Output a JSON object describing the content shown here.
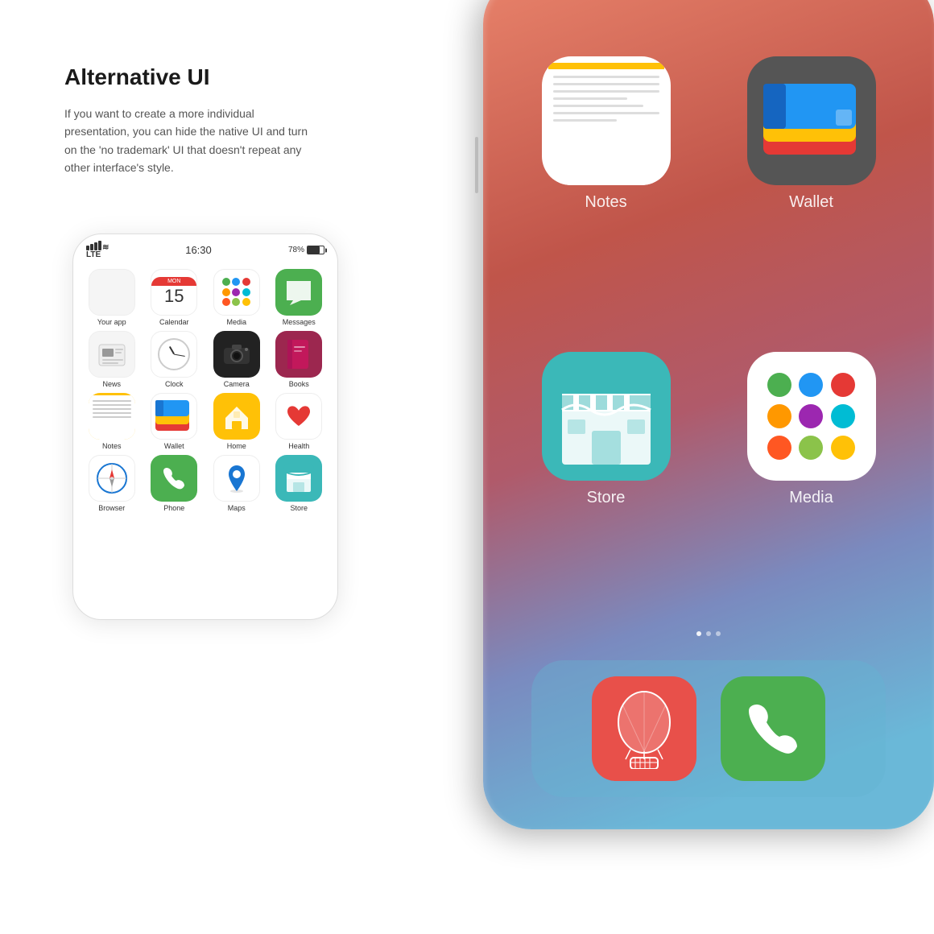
{
  "page": {
    "title": "Alternative UI",
    "description": "If you want to create a more individual presentation, you can hide the native UI and turn on the 'no trademark' UI that doesn't repeat any other interface's style."
  },
  "phone_small": {
    "status": {
      "signal": "▐▐▐▐ LTE",
      "wifi": "≋",
      "time": "16:30",
      "battery_pct": "78%"
    },
    "apps": [
      {
        "label": "Your app",
        "type": "your-app"
      },
      {
        "label": "Calendar",
        "type": "calendar",
        "date": "15"
      },
      {
        "label": "Media",
        "type": "media"
      },
      {
        "label": "Messages",
        "type": "messages"
      },
      {
        "label": "News",
        "type": "news"
      },
      {
        "label": "Clock",
        "type": "clock"
      },
      {
        "label": "Camera",
        "type": "camera"
      },
      {
        "label": "Books",
        "type": "books"
      },
      {
        "label": "Notes",
        "type": "notes"
      },
      {
        "label": "Wallet",
        "type": "wallet"
      },
      {
        "label": "Home",
        "type": "home"
      },
      {
        "label": "Health",
        "type": "health"
      },
      {
        "label": "Browser",
        "type": "browser"
      },
      {
        "label": "Phone",
        "type": "phone"
      },
      {
        "label": "Maps",
        "type": "maps"
      },
      {
        "label": "Store",
        "type": "store"
      }
    ]
  },
  "phone_large": {
    "apps_main": [
      {
        "label": "Notes",
        "type": "notes"
      },
      {
        "label": "Wallet",
        "type": "wallet"
      },
      {
        "label": "Store",
        "type": "store"
      },
      {
        "label": "Media",
        "type": "media"
      }
    ],
    "apps_dock": [
      {
        "label": "",
        "type": "balloon"
      },
      {
        "label": "",
        "type": "phone"
      }
    ]
  }
}
